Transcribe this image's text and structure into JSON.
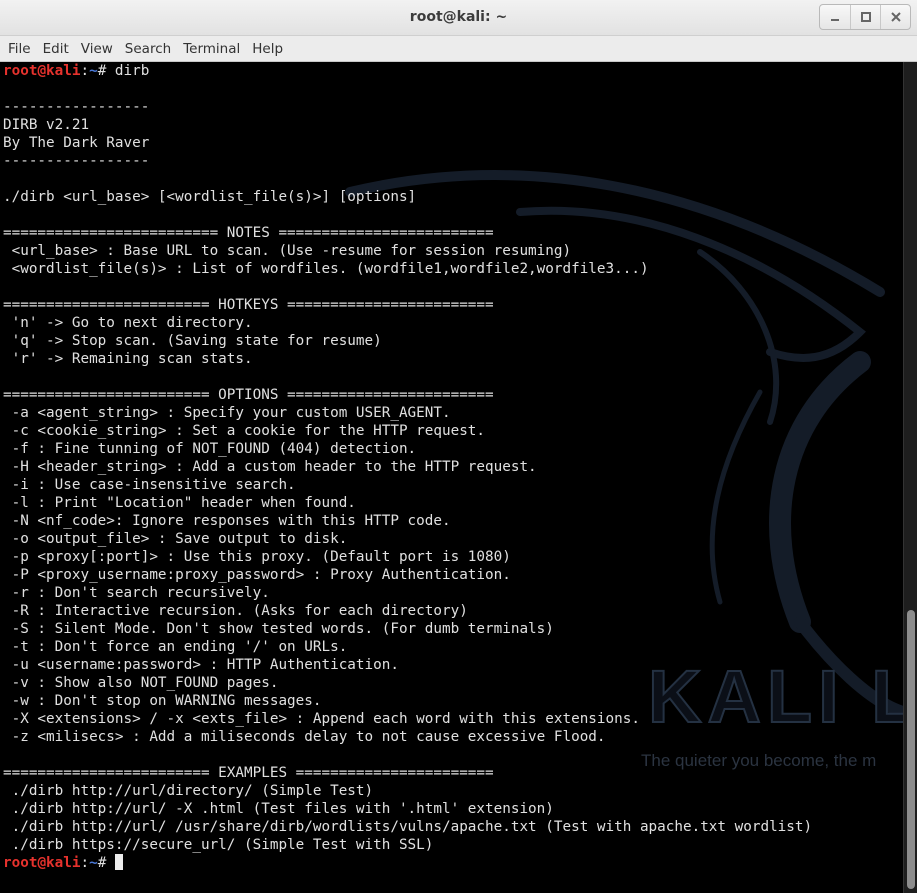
{
  "window": {
    "title": "root@kali: ~"
  },
  "menu": [
    "File",
    "Edit",
    "View",
    "Search",
    "Terminal",
    "Help"
  ],
  "prompt": {
    "user": "root",
    "at": "@",
    "host": "kali",
    "sep": ":",
    "path": "~",
    "symbol": "# "
  },
  "command": "dirb",
  "output": [
    "",
    "-----------------",
    "DIRB v2.21",
    "By The Dark Raver",
    "-----------------",
    "",
    "./dirb <url_base> [<wordlist_file(s)>] [options]",
    "",
    "========================= NOTES =========================",
    " <url_base> : Base URL to scan. (Use -resume for session resuming)",
    " <wordlist_file(s)> : List of wordfiles. (wordfile1,wordfile2,wordfile3...)",
    "",
    "======================== HOTKEYS ========================",
    " 'n' -> Go to next directory.",
    " 'q' -> Stop scan. (Saving state for resume)",
    " 'r' -> Remaining scan stats.",
    "",
    "======================== OPTIONS ========================",
    " -a <agent_string> : Specify your custom USER_AGENT.",
    " -c <cookie_string> : Set a cookie for the HTTP request.",
    " -f : Fine tunning of NOT_FOUND (404) detection.",
    " -H <header_string> : Add a custom header to the HTTP request.",
    " -i : Use case-insensitive search.",
    " -l : Print \"Location\" header when found.",
    " -N <nf_code>: Ignore responses with this HTTP code.",
    " -o <output_file> : Save output to disk.",
    " -p <proxy[:port]> : Use this proxy. (Default port is 1080)",
    " -P <proxy_username:proxy_password> : Proxy Authentication.",
    " -r : Don't search recursively.",
    " -R : Interactive recursion. (Asks for each directory)",
    " -S : Silent Mode. Don't show tested words. (For dumb terminals)",
    " -t : Don't force an ending '/' on URLs.",
    " -u <username:password> : HTTP Authentication.",
    " -v : Show also NOT_FOUND pages.",
    " -w : Don't stop on WARNING messages.",
    " -X <extensions> / -x <exts_file> : Append each word with this extensions.",
    " -z <milisecs> : Add a miliseconds delay to not cause excessive Flood.",
    "",
    "======================== EXAMPLES =======================",
    " ./dirb http://url/directory/ (Simple Test)",
    " ./dirb http://url/ -X .html (Test files with '.html' extension)",
    " ./dirb http://url/ /usr/share/dirb/wordlists/vulns/apache.txt (Test with apache.txt wordlist)",
    " ./dirb https://secure_url/ (Simple Test with SSL)"
  ],
  "wallpaper": {
    "brand": "KALI LI",
    "tagline": "The quieter you become, the m"
  },
  "colors": {
    "prompt_user": "#e6322d",
    "prompt_path": "#4a78d6",
    "terminal_bg": "#000000",
    "terminal_fg": "#e0e0e0"
  }
}
